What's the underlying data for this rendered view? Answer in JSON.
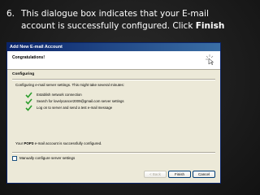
{
  "instruction": {
    "number": "6.",
    "line1": "This dialogue box indicates that your E-mail",
    "line2_prefix": "account is successfully configured. Click ",
    "line2_bold": "Finish"
  },
  "dialog": {
    "title": "Add New E-mail Account",
    "header_title": "Congratulations!",
    "section_title": "Configuring",
    "config_description": "Configuring e-mail server settings. This might take several minutes:",
    "tasks": [
      "Establish network connection",
      "Search for lovelycancer2009@gmail.com server settings",
      "Log on to server and send a test e-mail message"
    ],
    "success_prefix": "Your ",
    "success_bold": "POP3",
    "success_suffix": " e-mail account is successfully configured.",
    "manual_config_label": "Manually configure server settings",
    "buttons": {
      "back": "< Back",
      "finish": "Finish",
      "cancel": "Cancel"
    }
  },
  "colors": {
    "titlebar": "#0a246a",
    "dialog_bg": "#ece9d8",
    "check": "#2e9e2e"
  },
  "icons": [
    "wizard-cursor-icon",
    "checkmark-icon"
  ]
}
